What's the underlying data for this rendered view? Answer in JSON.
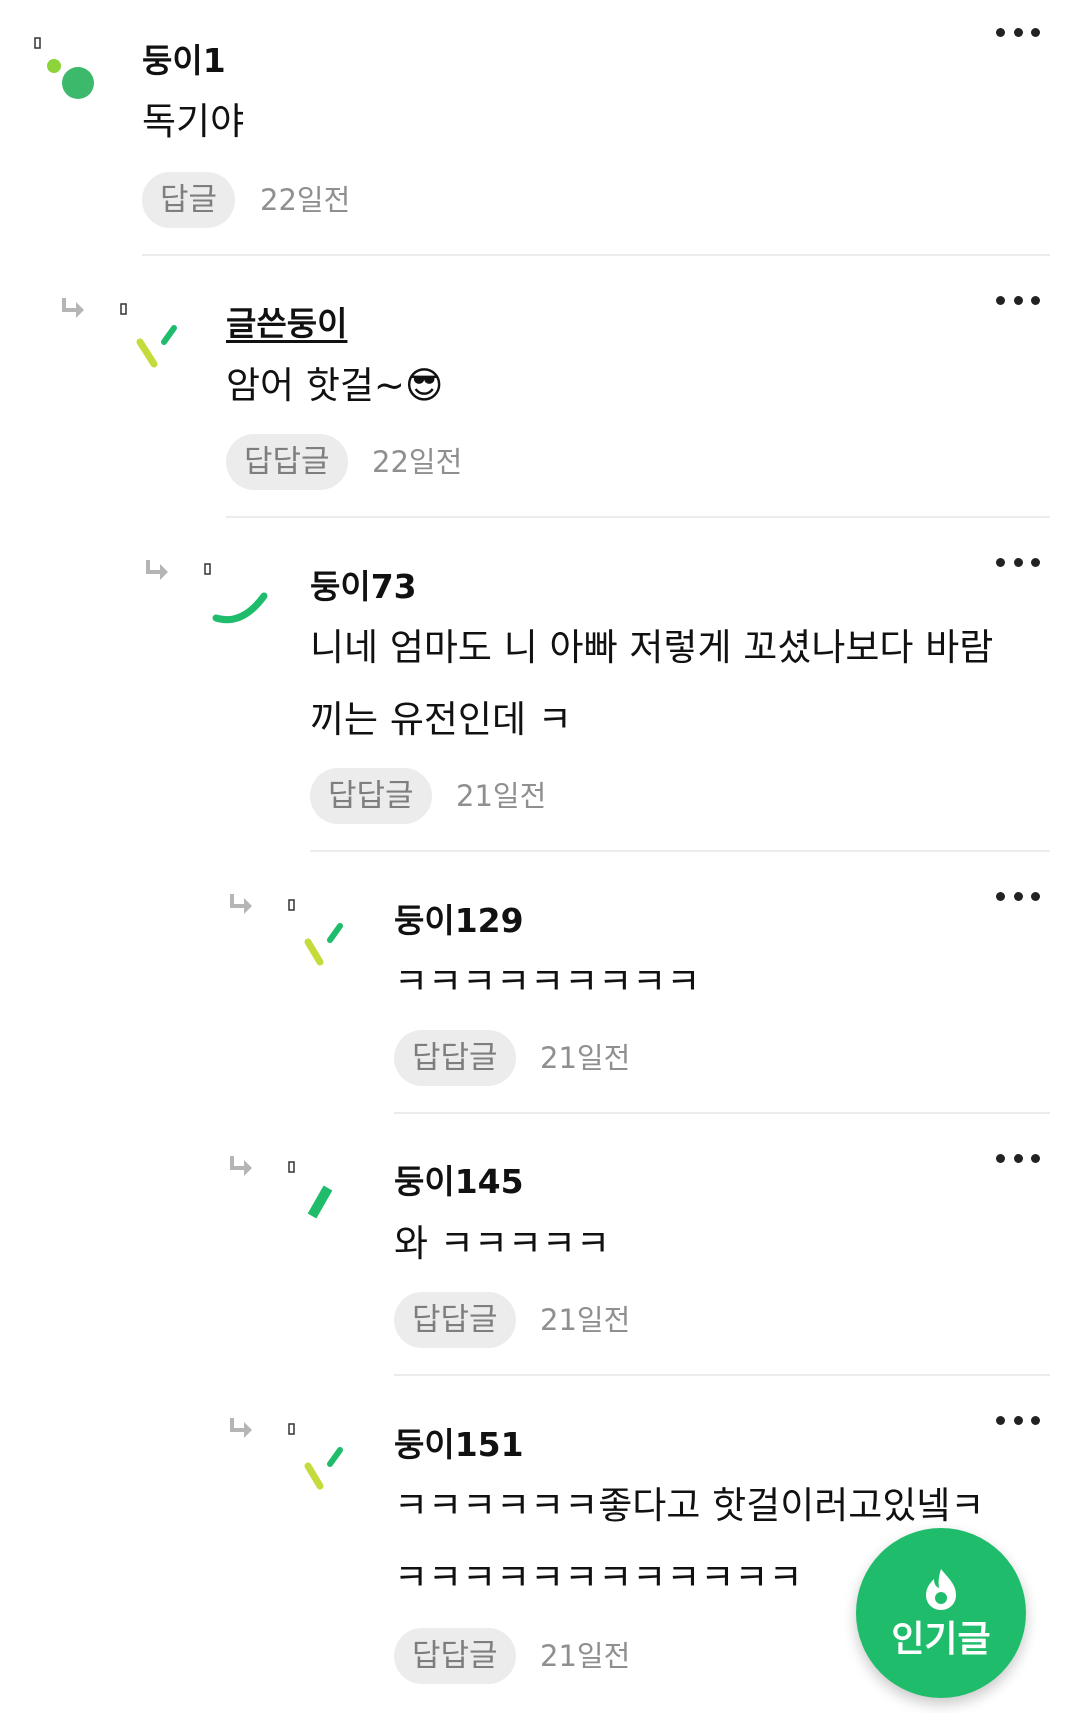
{
  "comments": [
    {
      "author": "둥이1",
      "text_lines": [
        "독기야"
      ],
      "reply_label": "답글",
      "time": "22일전",
      "depth": 0,
      "is_owner": false
    },
    {
      "author": "글쓴둥이",
      "text_lines": [
        "암어 핫걸~😎"
      ],
      "reply_label": "답답글",
      "time": "22일전",
      "depth": 1,
      "is_owner": true
    },
    {
      "author": "둥이73",
      "text_lines": [
        "니네 엄마도 니 아빠 저렇게 꼬셨나보다 바람",
        "끼는 유전인데 ㅋ"
      ],
      "reply_label": "답답글",
      "time": "21일전",
      "depth": 2,
      "is_owner": false
    },
    {
      "author": "둥이129",
      "text_lines": [
        "ㅋㅋㅋㅋㅋㅋㅋㅋㅋ"
      ],
      "reply_label": "답답글",
      "time": "21일전",
      "depth": 3,
      "is_owner": false
    },
    {
      "author": "둥이145",
      "text_lines": [
        "와 ㅋㅋㅋㅋㅋ"
      ],
      "reply_label": "답답글",
      "time": "21일전",
      "depth": 3,
      "is_owner": false
    },
    {
      "author": "둥이151",
      "text_lines": [
        "ㅋㅋㅋㅋㅋㅋ좋다고 핫걸이러고있넼ㅋ",
        "ㅋㅋㅋㅋㅋㅋㅋㅋㅋㅋㅋㅋ"
      ],
      "reply_label": "답답글",
      "time": "21일전",
      "depth": 3,
      "is_owner": false
    }
  ],
  "floating_button": {
    "label": "인기글",
    "icon": "flame-icon",
    "color": "#1fbd6b"
  },
  "icons": {
    "more": "more-options-icon",
    "reply_arrow": "reply-arrow-icon"
  },
  "colors": {
    "accent_green": "#1fbd6b",
    "avatar_light_green": "#8cd43a",
    "avatar_yellow_green": "#c5db3b",
    "chip_bg": "#ececec",
    "muted_text": "#8f8f8f"
  }
}
